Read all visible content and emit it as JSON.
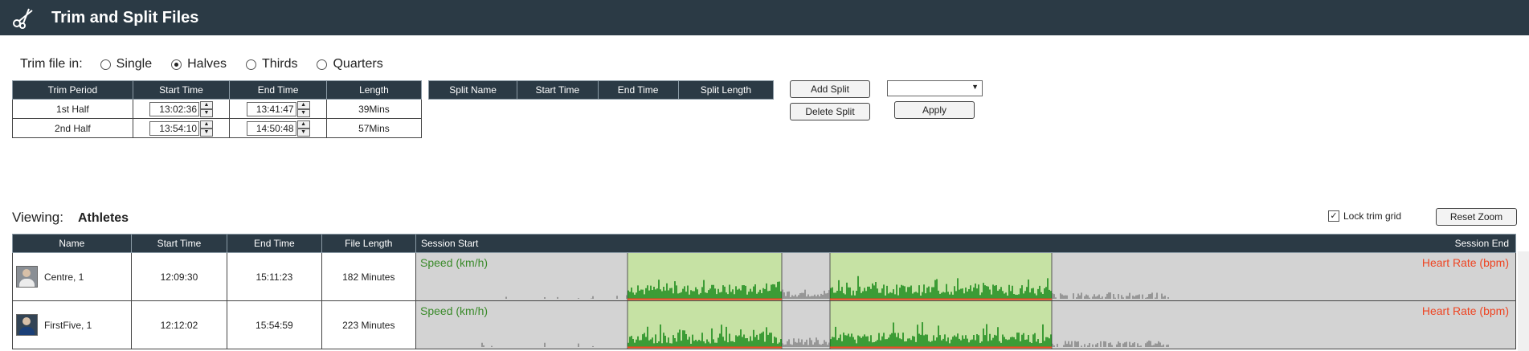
{
  "app": {
    "title": "Trim and Split Files",
    "icon": "scissors-icon"
  },
  "trim": {
    "label": "Trim file in:",
    "options": [
      "Single",
      "Halves",
      "Thirds",
      "Quarters"
    ],
    "selected": "Halves"
  },
  "trim_table": {
    "headers": [
      "Trim Period",
      "Start Time",
      "End Time",
      "Length"
    ],
    "rows": [
      {
        "period": "1st Half",
        "start": "13:02:36",
        "end": "13:41:47",
        "length": "39Mins"
      },
      {
        "period": "2nd Half",
        "start": "13:54:10",
        "end": "14:50:48",
        "length": "57Mins"
      }
    ]
  },
  "split_table": {
    "headers": [
      "Split Name",
      "Start Time",
      "End Time",
      "Split Length"
    ]
  },
  "buttons": {
    "add_split": "Add Split",
    "delete_split": "Delete Split",
    "apply": "Apply",
    "reset_zoom": "Reset Zoom"
  },
  "dropdown": {
    "value": ""
  },
  "viewing": {
    "label": "Viewing:",
    "value": "Athletes"
  },
  "lock": {
    "label": "Lock trim grid",
    "checked": true
  },
  "athletes_table": {
    "headers": [
      "Name",
      "Start Time",
      "End Time",
      "File Length"
    ],
    "session_start": "Session Start",
    "session_end": "Session End",
    "rows": [
      {
        "name": "Centre, 1",
        "start": "12:09:30",
        "end": "15:11:23",
        "length": "182 Minutes",
        "speed_label": "Speed (km/h)",
        "hr_label": "Heart Rate (bpm)"
      },
      {
        "name": "FirstFive, 1",
        "start": "12:12:02",
        "end": "15:54:59",
        "length": "223 Minutes",
        "speed_label": "Speed (km/h)",
        "hr_label": "Heart Rate (bpm)"
      }
    ]
  },
  "colors": {
    "header_bg": "#2b3a45",
    "trim_highlight": "#c6e2a4",
    "untrimmed": "#d3d3d3",
    "speed_active": "#1a8a1a",
    "speed_inactive": "#888888",
    "heart_rate": "#ee4422"
  }
}
